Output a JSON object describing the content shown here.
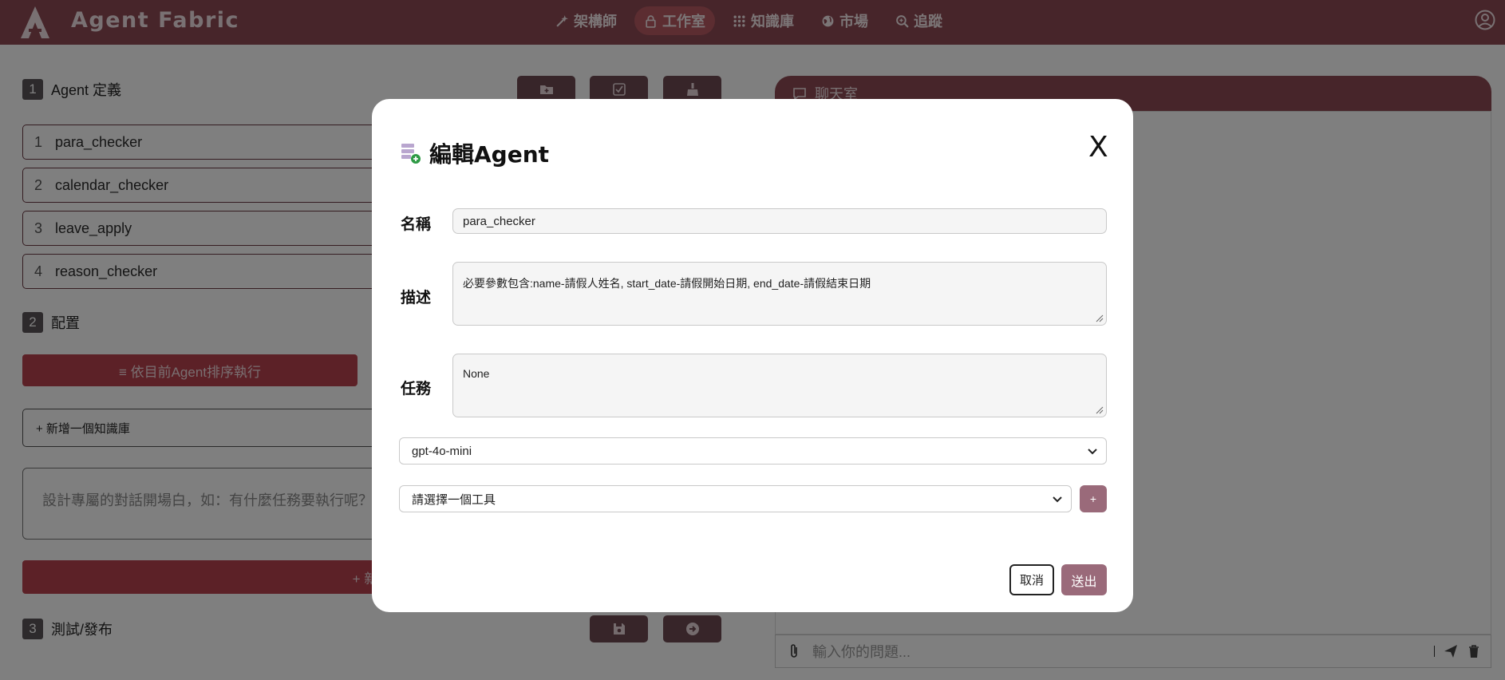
{
  "app": {
    "brand": "Agent Fabric"
  },
  "nav": {
    "items": [
      {
        "label": "架構師",
        "icon": "magic-wand-icon"
      },
      {
        "label": "工作室",
        "icon": "lock-icon",
        "active": true
      },
      {
        "label": "知識庫",
        "icon": "grid-icon"
      },
      {
        "label": "市場",
        "icon": "globe-icon"
      },
      {
        "label": "追蹤",
        "icon": "zoom-icon"
      }
    ]
  },
  "left": {
    "section1": {
      "number": "1",
      "title": "Agent 定義"
    },
    "agents": [
      {
        "index": "1",
        "name": "para_checker"
      },
      {
        "index": "2",
        "name": "calendar_checker"
      },
      {
        "index": "3",
        "name": "leave_apply"
      },
      {
        "index": "4",
        "name": "reason_checker"
      }
    ],
    "section2": {
      "number": "2",
      "title": "配置"
    },
    "run_button": "≡ 依目前Agent排序執行",
    "kb_add": "+ 新增一個知識庫",
    "opening_placeholder": "設計專屬的對話開場白，如：有什麼任務要執行呢？",
    "add_button": "+ 新增",
    "section3": {
      "number": "3",
      "title": "測試/發布"
    }
  },
  "chat": {
    "title": "聊天室",
    "input_placeholder": "輸入你的問題..."
  },
  "modal": {
    "title": "編輯Agent",
    "close": "X",
    "name_label": "名稱",
    "name_value": "para_checker",
    "desc_label": "描述",
    "desc_value": "必要參數包含:name-請假人姓名, start_date-請假開始日期, end_date-請假結束日期",
    "task_label": "任務",
    "task_value": "None",
    "model_value": "gpt-4o-mini",
    "tool_placeholder": "請選擇一個工具",
    "plus": "+",
    "cancel": "取消",
    "submit": "送出"
  },
  "colors": {
    "primary": "#8e4a55",
    "accent": "#b8434f",
    "button": "#9a6a7a"
  }
}
